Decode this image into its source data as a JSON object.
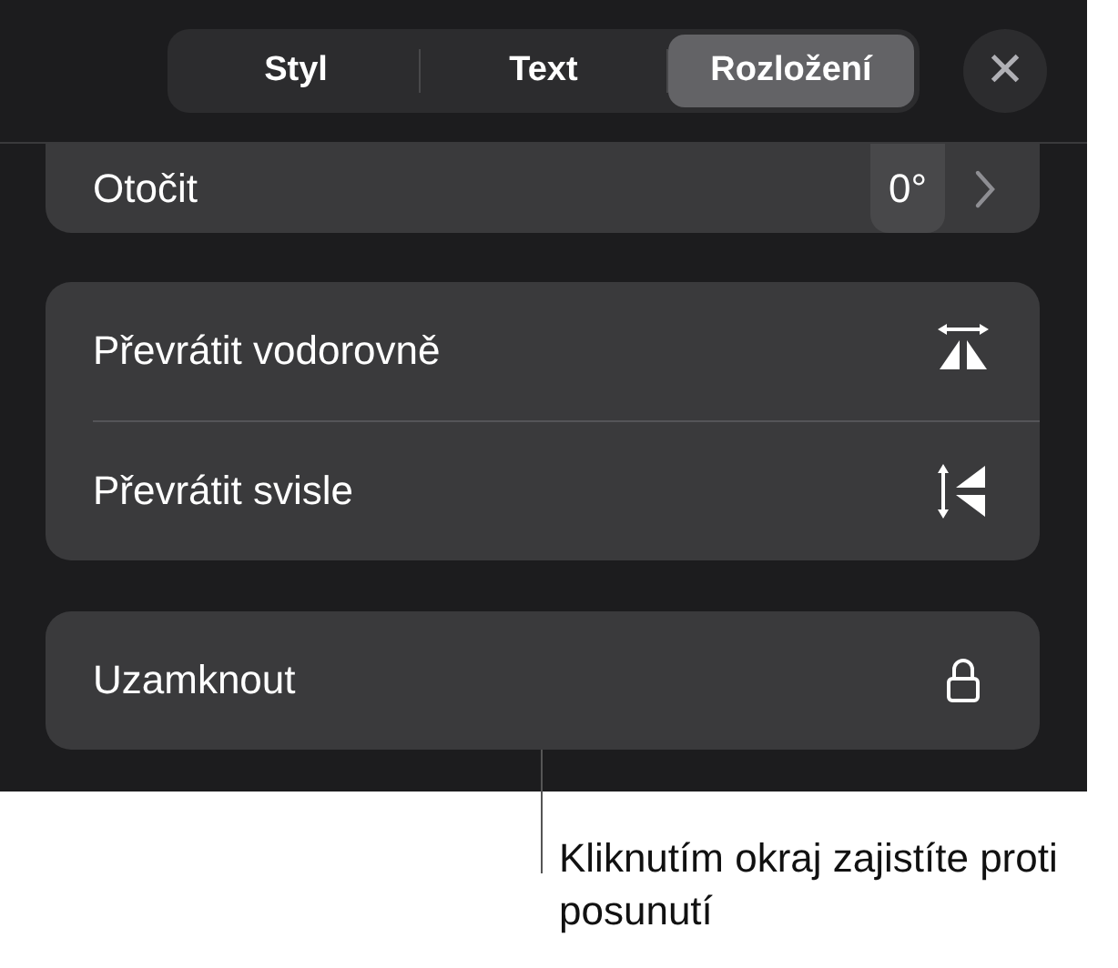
{
  "tabs": [
    {
      "label": "Styl",
      "selected": false
    },
    {
      "label": "Text",
      "selected": false
    },
    {
      "label": "Rozložení",
      "selected": true
    }
  ],
  "close": {
    "label": "✕"
  },
  "rotate": {
    "label": "Otočit",
    "value": "0°"
  },
  "flip_group": [
    {
      "label": "Převrátit vodorovně",
      "kind": "horizontal"
    },
    {
      "label": "Převrátit svisle",
      "kind": "vertical"
    }
  ],
  "lock": {
    "label": "Uzamknout"
  },
  "callout": "Kliknutím okraj zajistíte proti posunutí"
}
